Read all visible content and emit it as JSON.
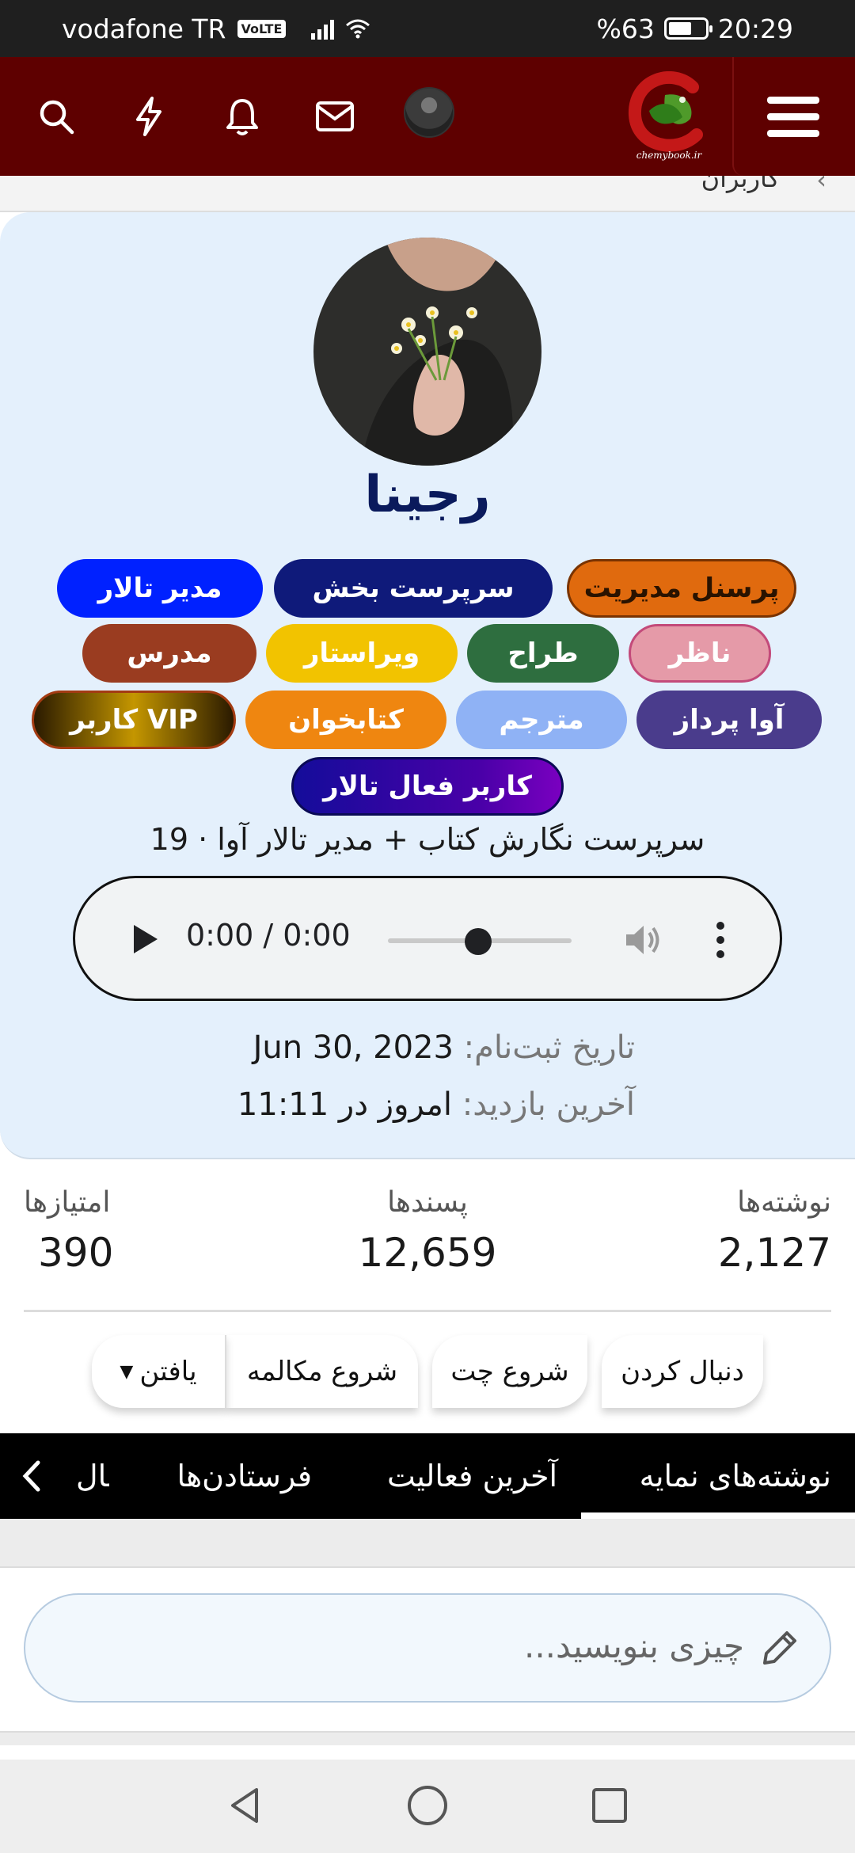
{
  "status_bar": {
    "carrier": "vodafone TR",
    "volte": "VoLTE",
    "battery": "%63",
    "battery_level": 0.63,
    "time": "20:29"
  },
  "app_bar": {
    "icons": [
      "search-icon",
      "bolt-icon",
      "bell-icon",
      "mail-icon"
    ],
    "avatar": "user-avatar",
    "logo_text": "chemybook.ir",
    "menu_icon": "hamburger-menu-icon",
    "color": "#5e0000"
  },
  "breadcrumb": {
    "label": "کاربران"
  },
  "profile": {
    "username": "رجینا",
    "badges": [
      {
        "label": "پرسنل مدیریت",
        "color": "#e06a0e"
      },
      {
        "label": "سرپرست بخش",
        "color": "#0f1a7a"
      },
      {
        "label": "مدیر تالار",
        "color": "#0021ff"
      },
      {
        "label": "ناظر",
        "color": "#e59aa8"
      },
      {
        "label": "طراح",
        "color": "#2e6e3f"
      },
      {
        "label": "ویراستار",
        "color": "#f2c300"
      },
      {
        "label": "مدرس",
        "color": "#9a3c20"
      },
      {
        "label": "آوا پرداز",
        "color": "#4a3c8c"
      },
      {
        "label": "مترجم",
        "color": "#8fb2f5"
      },
      {
        "label": "کتابخوان",
        "color": "#ef8610"
      },
      {
        "label": "کاربر VIP",
        "color": "#1b1400"
      },
      {
        "label": "کاربر فعال تالار",
        "color": "#3500a0"
      }
    ],
    "signature": "19 · سرپرست نگارش کتاب + مدیر تالار آوا",
    "audio": {
      "time": "0:00 / 0:00",
      "progress": 0.5
    },
    "joined_label": "تاریخ ثبت‌نام:",
    "joined_value": "Jun 30, 2023",
    "last_seen_label": "آخرین بازدید:",
    "last_seen_value": "امروز در 11:11"
  },
  "stats": [
    {
      "label": "نوشته‌ها",
      "value": "2,127"
    },
    {
      "label": "پسندها",
      "value": "12,659"
    },
    {
      "label": "امتیازها",
      "value": "390"
    }
  ],
  "actions": {
    "follow": "دنبال کردن",
    "start_chat": "شروع چت",
    "start_conversation": "شروع مکالمه",
    "find": "یافتن"
  },
  "tabs": [
    "نوشته‌های نمایه",
    "آخرین فعالیت",
    "فرستادن‌ها",
    "ارسال"
  ],
  "composer": {
    "placeholder": "چیزی بنویسید..."
  },
  "nav": [
    "back-icon",
    "home-icon",
    "recents-icon"
  ]
}
